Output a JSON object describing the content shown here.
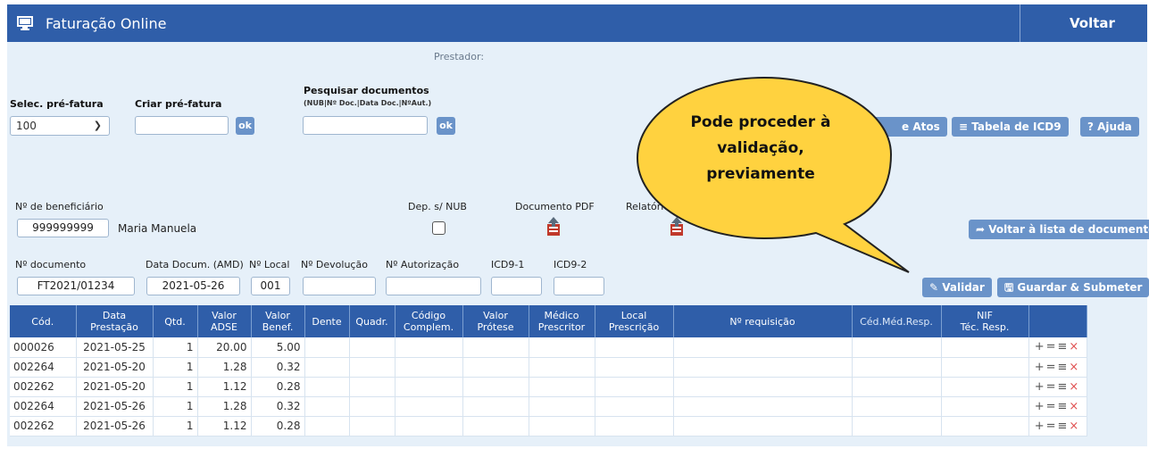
{
  "header": {
    "title": "Faturação Online",
    "back_label": "Voltar"
  },
  "prestador_label": "Prestador:",
  "prefatura": {
    "select_label": "Selec. pré-fatura",
    "select_value": "100",
    "create_label": "Criar pré-fatura",
    "create_value": "",
    "create_ok": "ok"
  },
  "search": {
    "label": "Pesquisar documentos",
    "hint": "(NUB|Nº Doc.|Data Doc.|NºAut.)",
    "value": "",
    "ok": "ok"
  },
  "top_buttons": {
    "atos": "e Atos",
    "icd9_table": "Tabela de ICD9",
    "help": "Ajuda"
  },
  "beneficiary": {
    "label": "Nº de beneficiário",
    "number": "999999999",
    "name": "Maria Manuela",
    "dep_label": "Dep. s/ NUB",
    "pdf_label": "Documento PDF",
    "report_label": "Relatório médico",
    "back_to_list": "Voltar à lista de documentos"
  },
  "document": {
    "num_label": "Nº documento",
    "num_value": "FT2021/01234",
    "date_label": "Data Docum. (AMD)",
    "date_value": "2021-05-26",
    "local_label": "Nº Local",
    "local_value": "001",
    "devol_label": "Nº Devolução",
    "devol_value": "",
    "autor_label": "Nº Autorização",
    "autor_value": "",
    "icd1_label": "ICD9-1",
    "icd1_value": "",
    "icd2_label": "ICD9-2",
    "icd2_value": "",
    "validate": "Validar",
    "save_submit": "Guardar & Submeter"
  },
  "callout": {
    "line1": "Pode proceder à",
    "line2": "validação,",
    "line3": "previamente"
  },
  "table": {
    "headers": [
      [
        "Cód.",
        ""
      ],
      [
        "Data",
        "Prestação"
      ],
      [
        "Qtd.",
        ""
      ],
      [
        "Valor",
        "ADSE"
      ],
      [
        "Valor",
        "Benef."
      ],
      [
        "Dente",
        ""
      ],
      [
        "Quadr.",
        ""
      ],
      [
        "Código",
        "Complem."
      ],
      [
        "Valor",
        "Prótese"
      ],
      [
        "Médico",
        "Prescritor"
      ],
      [
        "Local",
        "Prescrição"
      ],
      [
        "Nº requisição",
        ""
      ],
      [
        "Céd.Méd.Resp.",
        ""
      ],
      [
        "NIF",
        "Téc. Resp."
      ],
      [
        "",
        ""
      ]
    ],
    "rows": [
      {
        "cod": "000026",
        "data": "2021-05-25",
        "qtd": "1",
        "adse": "20.00",
        "benef": "5.00"
      },
      {
        "cod": "002264",
        "data": "2021-05-20",
        "qtd": "1",
        "adse": "1.28",
        "benef": "0.32"
      },
      {
        "cod": "002262",
        "data": "2021-05-20",
        "qtd": "1",
        "adse": "1.12",
        "benef": "0.28"
      },
      {
        "cod": "002264",
        "data": "2021-05-26",
        "qtd": "1",
        "adse": "1.28",
        "benef": "0.32"
      },
      {
        "cod": "002262",
        "data": "2021-05-26",
        "qtd": "1",
        "adse": "1.12",
        "benef": "0.28"
      }
    ]
  }
}
